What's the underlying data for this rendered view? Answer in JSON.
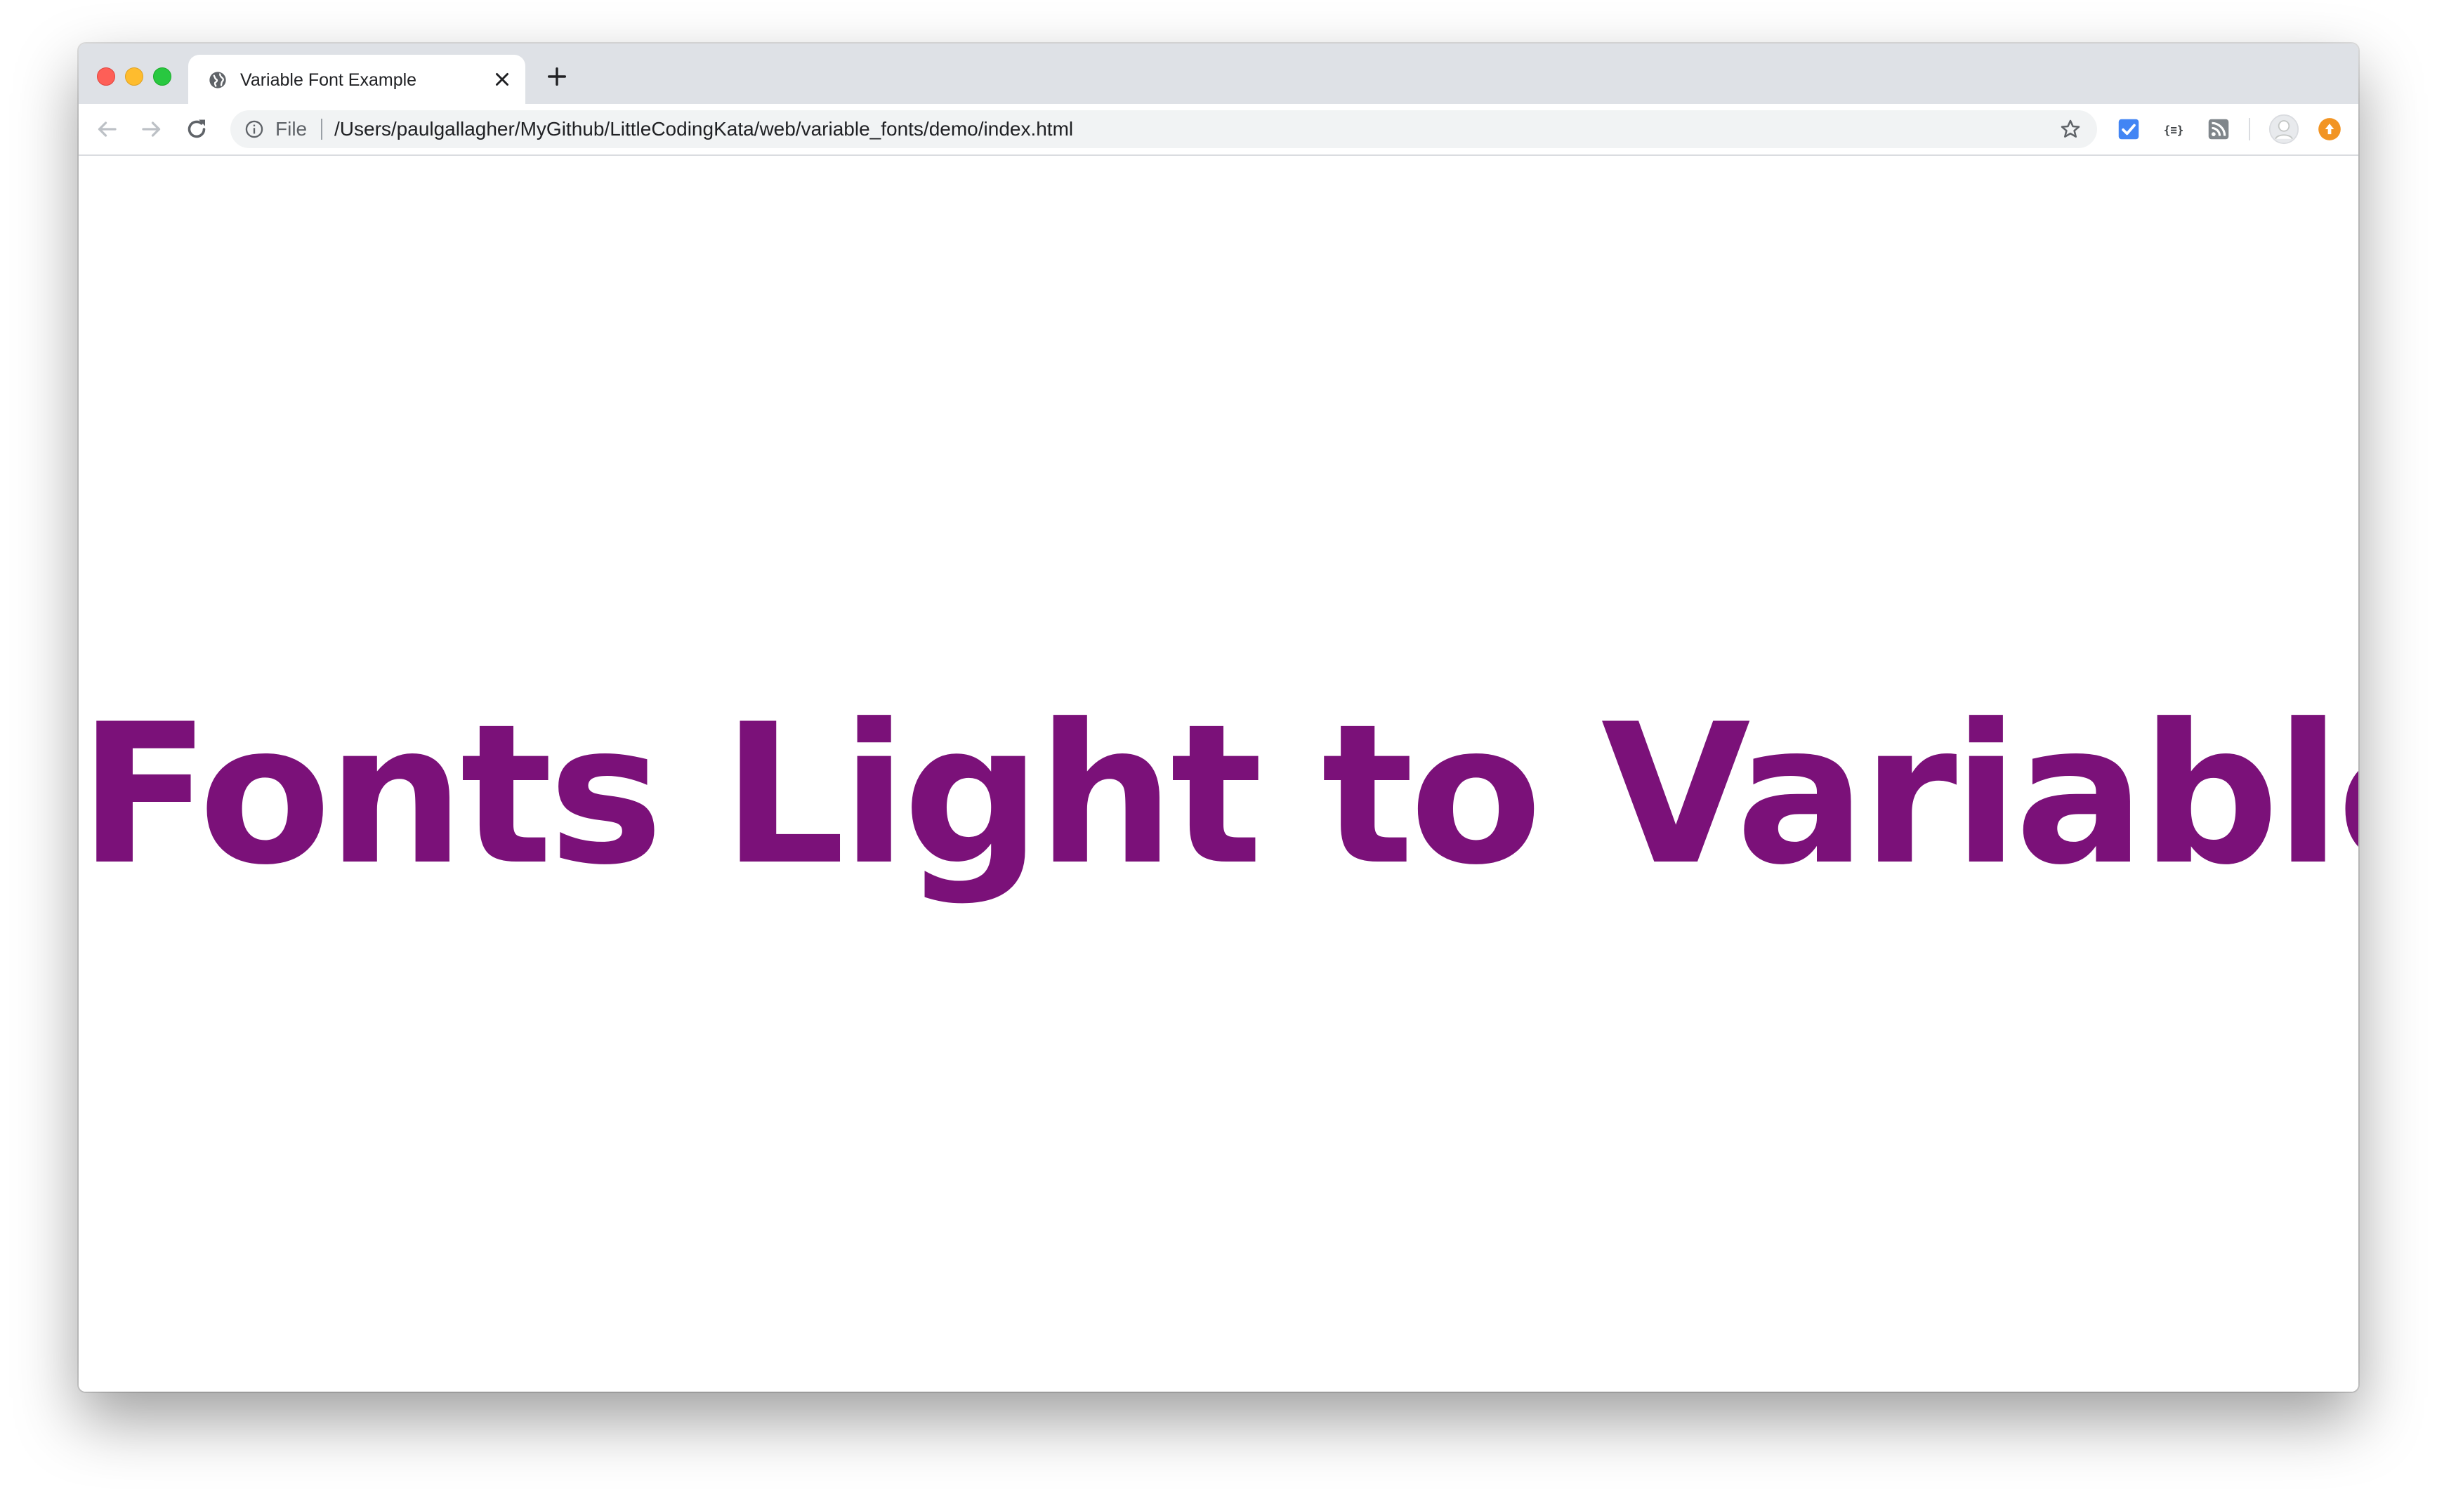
{
  "window": {
    "controls": [
      "close",
      "minimize",
      "zoom"
    ]
  },
  "tab": {
    "title": "Variable Font Example",
    "favicon": "globe-icon"
  },
  "toolbar": {
    "back_icon": "back-arrow-icon",
    "forward_icon": "forward-arrow-icon",
    "reload_icon": "reload-icon",
    "omnibox": {
      "scheme_label": "File",
      "url": "/Users/paulgallagher/MyGithub/LittleCodingKata/web/variable_fonts/demo/index.html"
    },
    "extensions": [
      "checklist-extension-icon",
      "json-formatter-icon",
      "rss-feed-icon"
    ],
    "profile_icon": "profile-avatar-icon",
    "update_icon": "update-badge-icon"
  },
  "page": {
    "headline": "Fonts Light to Variable",
    "headline_color": "#7b1179"
  },
  "colors": {
    "tabstrip": "#dee1e6",
    "omnibox": "#f1f3f4",
    "close_light": "#fe5f57",
    "minimize_light": "#febc2e",
    "zoom_light": "#28c840",
    "ext_blue": "#4285f4",
    "update_orange": "#f29423"
  }
}
